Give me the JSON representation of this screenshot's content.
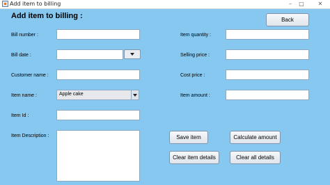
{
  "window": {
    "title": "Add item to billing",
    "controls": {
      "minimize": "–",
      "maximize": "□",
      "close": "✕"
    }
  },
  "form": {
    "heading": "Add item to billing :",
    "back_label": "Back",
    "left_fields": {
      "bill_number": {
        "label": "Bill number :",
        "value": ""
      },
      "bill_date": {
        "label": "Bill date :",
        "value": ""
      },
      "customer_name": {
        "label": "Customer name :",
        "value": ""
      },
      "item_name": {
        "label": "Item name :",
        "selected": "Apple cake"
      },
      "item_id": {
        "label": "Item Id :",
        "value": ""
      },
      "item_description": {
        "label": "Item Description :",
        "value": ""
      }
    },
    "right_fields": {
      "item_quantity": {
        "label": "Item quantity :",
        "value": ""
      },
      "selling_price": {
        "label": "Selling price :",
        "value": ""
      },
      "cost_price": {
        "label": "Cost price :",
        "value": ""
      },
      "item_amount": {
        "label": "Item amount :",
        "value": ""
      }
    },
    "buttons": {
      "save_item": "Save item",
      "calculate_amount": "Calculate amount",
      "clear_item_details": "Clear item details",
      "clear_all_details": "Clear all details"
    }
  },
  "colors": {
    "background": "#87c8f0",
    "field_border": "#8fa9c4"
  },
  "icons": {
    "app": "java-app-icon",
    "date_dropdown": "dropdown-arrow-icon",
    "combo_dropdown": "dropdown-arrow-icon"
  }
}
